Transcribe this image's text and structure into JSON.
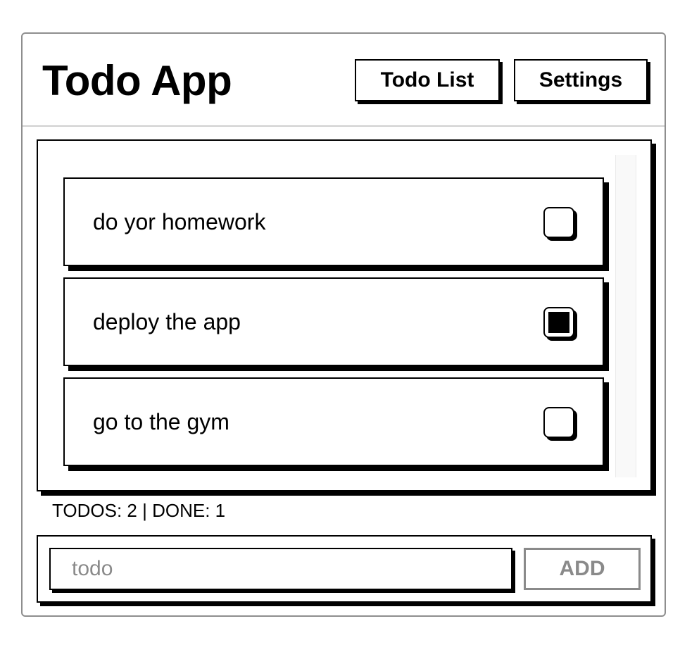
{
  "header": {
    "title": "Todo App",
    "nav": {
      "todo_list_label": "Todo List",
      "settings_label": "Settings"
    }
  },
  "todos": [
    {
      "text": "do yor homework",
      "done": false
    },
    {
      "text": "deploy the app",
      "done": true
    },
    {
      "text": "go to the gym",
      "done": false
    }
  ],
  "stats": {
    "summary": "TODOS: 2 | DONE: 1"
  },
  "add_form": {
    "input_placeholder": "todo",
    "input_value": "",
    "add_label": "ADD"
  },
  "colors": {
    "border": "#000000",
    "frame_border": "#8e8e8e",
    "disabled": "#8a8a8a"
  },
  "icons": {
    "checkbox_unchecked": "checkbox-empty-icon",
    "checkbox_checked": "checkbox-filled-icon"
  }
}
